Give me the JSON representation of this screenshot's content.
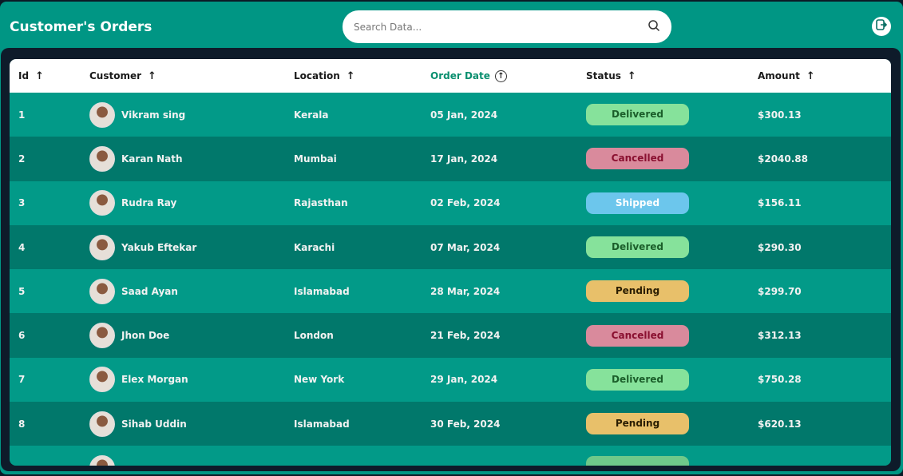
{
  "header": {
    "title": "Customer's Orders",
    "search_placeholder": "Search Data..."
  },
  "columns": [
    "Id",
    "Customer",
    "Location",
    "Order Date",
    "Status",
    "Amount"
  ],
  "status_colors": {
    "Delivered": {
      "bg": "#86e29b",
      "fg": "#1b5e2a"
    },
    "Cancelled": {
      "bg": "#d98a9c",
      "fg": "#8a1030"
    },
    "Shipped": {
      "bg": "#6cc6ec",
      "fg": "#ffffff"
    },
    "Pending": {
      "bg": "#e8c06a",
      "fg": "#2a1d00"
    }
  },
  "rows": [
    {
      "id": "1",
      "customer": "Vikram sing",
      "location": "Kerala",
      "date": "05 Jan, 2024",
      "status": "Delivered",
      "amount": "$300.13"
    },
    {
      "id": "2",
      "customer": "Karan Nath",
      "location": "Mumbai",
      "date": "17 Jan, 2024",
      "status": "Cancelled",
      "amount": "$2040.88"
    },
    {
      "id": "3",
      "customer": "Rudra Ray",
      "location": "Rajasthan",
      "date": "02 Feb, 2024",
      "status": "Shipped",
      "amount": "$156.11"
    },
    {
      "id": "4",
      "customer": "Yakub Eftekar",
      "location": "Karachi",
      "date": "07 Mar, 2024",
      "status": "Delivered",
      "amount": "$290.30"
    },
    {
      "id": "5",
      "customer": "Saad Ayan",
      "location": "Islamabad",
      "date": "28 Mar, 2024",
      "status": "Pending",
      "amount": "$299.70"
    },
    {
      "id": "6",
      "customer": "Jhon Doe",
      "location": "London",
      "date": "21 Feb, 2024",
      "status": "Cancelled",
      "amount": "$312.13"
    },
    {
      "id": "7",
      "customer": "Elex Morgan",
      "location": "New York",
      "date": "29 Jan, 2024",
      "status": "Delivered",
      "amount": "$750.28"
    },
    {
      "id": "8",
      "customer": "Sihab Uddin",
      "location": "Islamabad",
      "date": "30 Feb, 2024",
      "status": "Pending",
      "amount": "$620.13"
    }
  ]
}
